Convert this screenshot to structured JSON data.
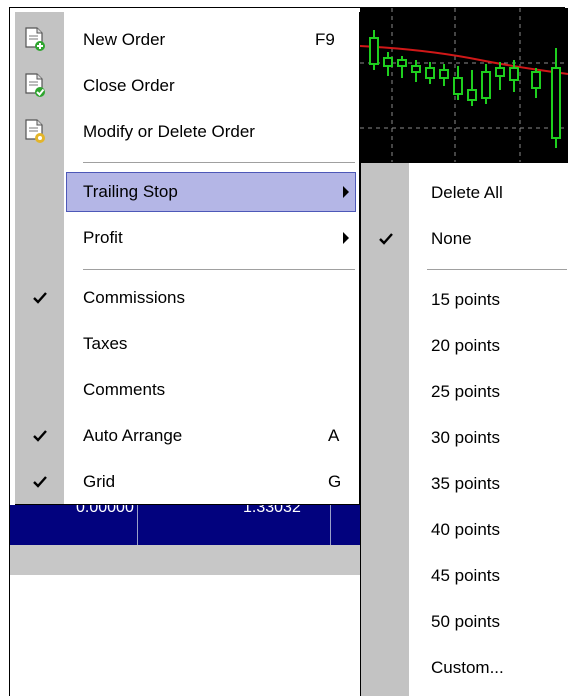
{
  "main_menu": {
    "new_order": {
      "label": "New Order",
      "shortcut": "F9",
      "icon": "document-add-icon"
    },
    "close_order": {
      "label": "Close Order",
      "icon": "document-check-icon"
    },
    "modify_order": {
      "label": "Modify or Delete Order",
      "icon": "document-gear-icon"
    },
    "trailing_stop": {
      "label": "Trailing Stop",
      "highlighted": true
    },
    "profit": {
      "label": "Profit"
    },
    "commissions": {
      "label": "Commissions",
      "checked": true
    },
    "taxes": {
      "label": "Taxes",
      "checked": false
    },
    "comments": {
      "label": "Comments",
      "checked": false
    },
    "auto_arrange": {
      "label": "Auto Arrange",
      "shortcut": "A",
      "checked": true
    },
    "grid": {
      "label": "Grid",
      "shortcut": "G",
      "checked": true
    }
  },
  "submenu": {
    "delete_all": {
      "label": "Delete All"
    },
    "none": {
      "label": "None",
      "checked": true
    },
    "items": [
      {
        "label": "15 points"
      },
      {
        "label": "20 points"
      },
      {
        "label": "25 points"
      },
      {
        "label": "30 points"
      },
      {
        "label": "35 points"
      },
      {
        "label": "40 points"
      },
      {
        "label": "45 points"
      },
      {
        "label": "50 points"
      },
      {
        "label": "Custom..."
      }
    ]
  },
  "terminal": {
    "col1": "0.00000",
    "col2": "1.33032"
  },
  "colors": {
    "highlight": "#b4b6e6",
    "highlight_border": "#4d58b8",
    "gutter": "#c3c3c3",
    "terminal_bg": "#02027e",
    "chart_bg": "#000000"
  }
}
